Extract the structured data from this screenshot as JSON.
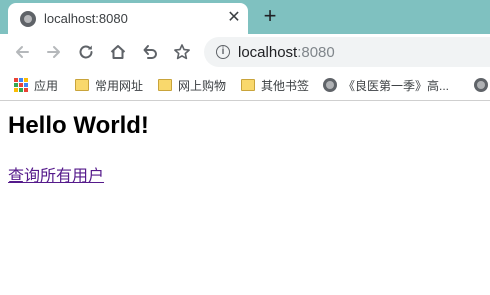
{
  "tab": {
    "title": "localhost:8080",
    "close_glyph": "✕",
    "new_tab_glyph": "+",
    "favicon": "globe-icon"
  },
  "toolbar": {
    "back_icon": "back-arrow-icon",
    "forward_icon": "forward-arrow-icon",
    "reload_icon": "reload-icon",
    "home_icon": "home-icon",
    "undo_icon": "undo-icon",
    "star_icon": "star-icon"
  },
  "omnibox": {
    "info_glyph": "i",
    "host": "localhost",
    "port": ":8080"
  },
  "bookmarks": [
    {
      "label": "应用",
      "icon": "apps-icon"
    },
    {
      "label": "常用网址",
      "icon": "folder-icon"
    },
    {
      "label": "网上购物",
      "icon": "folder-icon"
    },
    {
      "label": "其他书签",
      "icon": "folder-icon"
    },
    {
      "label": "《良医第一季》高...",
      "icon": "globe-icon"
    },
    {
      "label": "",
      "icon": "globe-icon"
    }
  ],
  "page": {
    "heading": "Hello World!",
    "link_text": "查询所有用户"
  },
  "colors": {
    "tabstrip": "#7fc1c0",
    "link_visited": "#551a8b",
    "folder": "#f9d86c"
  }
}
